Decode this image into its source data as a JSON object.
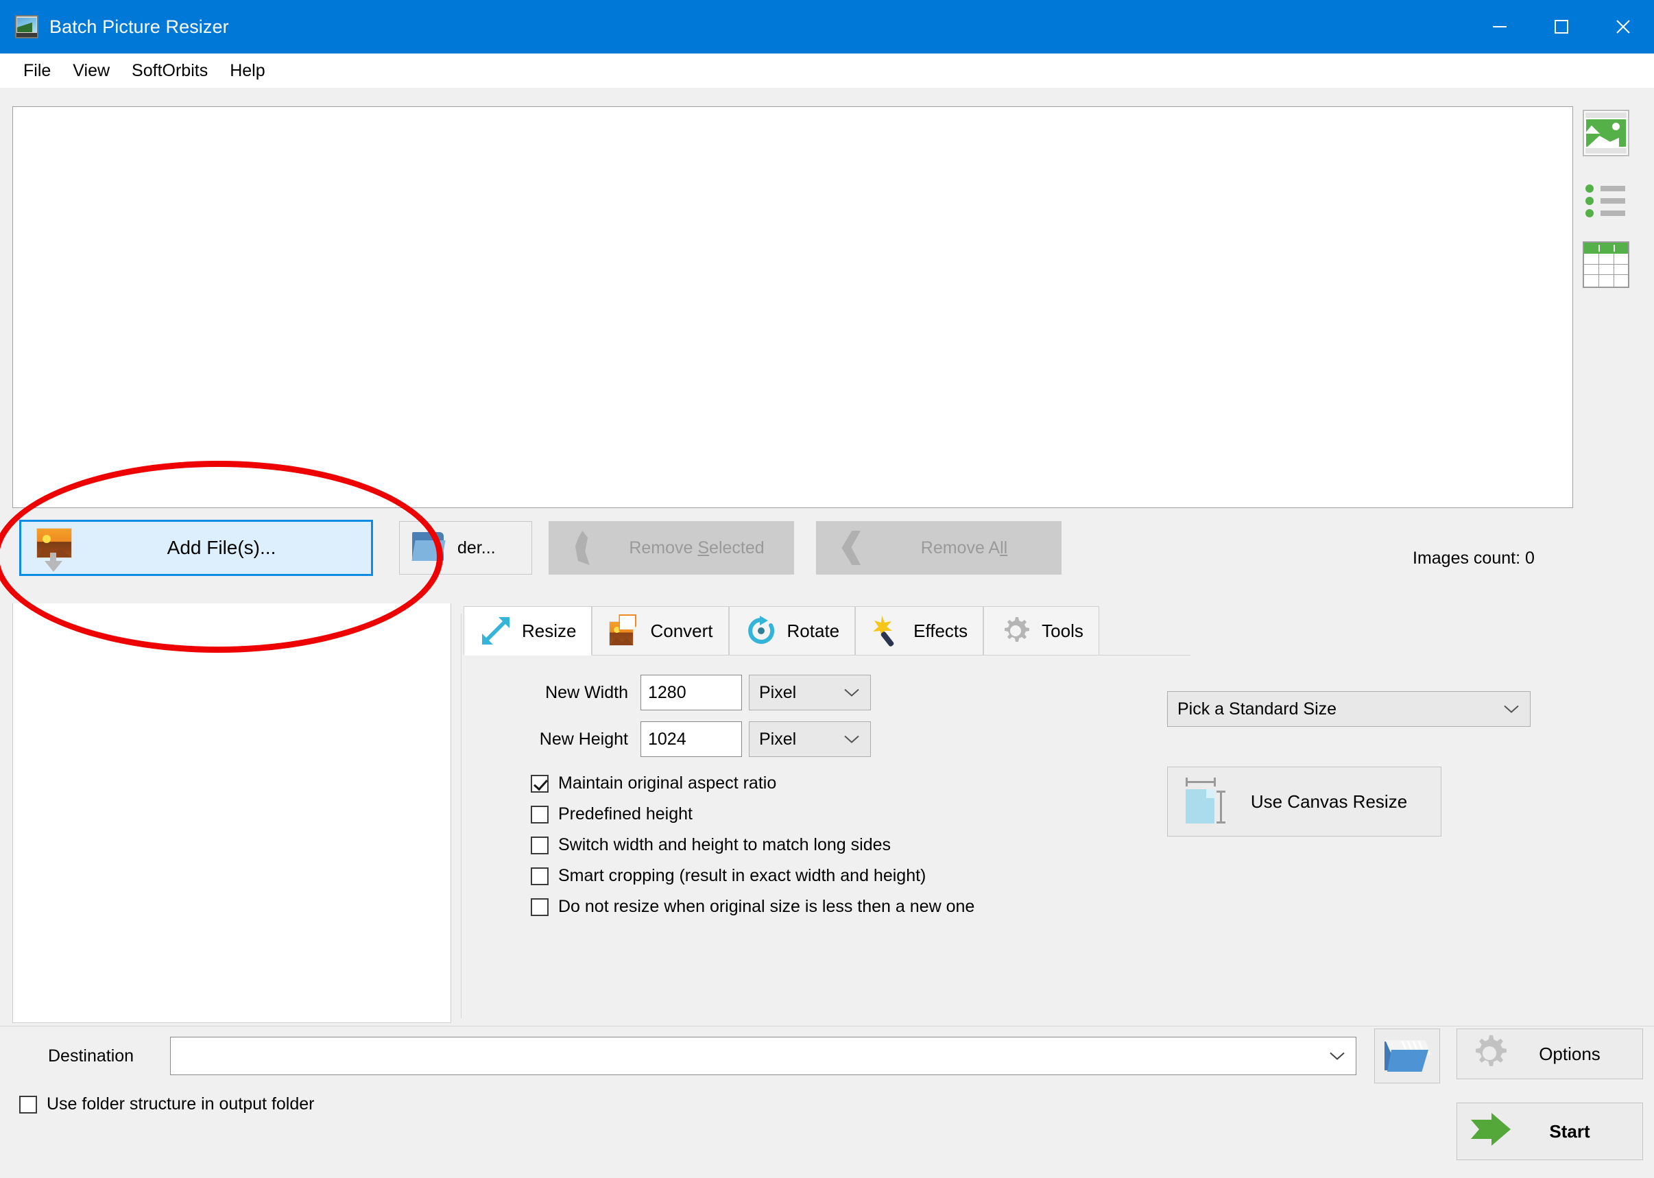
{
  "window": {
    "title": "Batch Picture Resizer",
    "app_icon": "picture-app-icon",
    "titlebar_color": "#0078d7",
    "controls": {
      "minimize": "minimize-icon",
      "maximize": "maximize-icon",
      "close": "close-icon"
    }
  },
  "menubar": {
    "items": [
      {
        "label": "File"
      },
      {
        "label": "View"
      },
      {
        "label": "SoftOrbits"
      },
      {
        "label": "Help"
      }
    ]
  },
  "view_modes": [
    {
      "name": "thumbnail-view",
      "icon": "thumbnail-view-icon"
    },
    {
      "name": "list-view",
      "icon": "list-view-icon"
    },
    {
      "name": "table-view",
      "icon": "table-view-icon"
    }
  ],
  "toolbar": {
    "add_files": {
      "label": "Add File(s)...",
      "icon": "add-picture-icon",
      "state": "focused",
      "accent": "#0c8ce4",
      "fill": "#ddeffc"
    },
    "add_folder": {
      "label": "der...",
      "full_label": "Add Folder...",
      "icon": "folder-icon"
    },
    "remove_selected": {
      "label_a": "Remove ",
      "label_accel": "S",
      "label_b": "elected",
      "icon": "remove-selected-icon",
      "state": "disabled"
    },
    "remove_all": {
      "label_a": "Remove A",
      "label_accel": "ll",
      "label_b": "",
      "icon": "remove-all-icon",
      "state": "disabled"
    },
    "images_count": "Images count: 0"
  },
  "tabs": [
    {
      "label": "Resize",
      "icon": "resize-arrows-icon",
      "active": true
    },
    {
      "label": "Convert",
      "icon": "convert-picture-icon",
      "active": false
    },
    {
      "label": "Rotate",
      "icon": "rotate-icon",
      "active": false
    },
    {
      "label": "Effects",
      "icon": "magic-wand-icon",
      "active": false
    },
    {
      "label": "Tools",
      "icon": "gear-icon",
      "active": false
    }
  ],
  "resize": {
    "new_width": {
      "label": "New Width",
      "value": "1280",
      "unit": "Pixel"
    },
    "new_height": {
      "label": "New Height",
      "value": "1024",
      "unit": "Pixel"
    },
    "standard_size": {
      "value": "Pick a Standard Size"
    },
    "canvas_resize": {
      "label": "Use Canvas Resize",
      "icon": "canvas-resize-icon"
    },
    "checkboxes": [
      {
        "label": "Maintain original aspect ratio",
        "checked": true
      },
      {
        "label": "Predefined height",
        "checked": false
      },
      {
        "label": "Switch width and height to match long sides",
        "checked": false
      },
      {
        "label": "Smart cropping (result in exact width and height)",
        "checked": false
      },
      {
        "label": "Do not resize when original size is less then a new one",
        "checked": false
      }
    ]
  },
  "bottom": {
    "destination_label": "Destination",
    "destination_value": "",
    "destination_placeholder": "",
    "browse": {
      "icon": "open-folder-icon"
    },
    "options": {
      "label": "Options",
      "icon": "gear-icon"
    },
    "start": {
      "label": "Start",
      "icon": "green-arrow-icon",
      "accent": "#54a83a"
    },
    "use_folder_structure": {
      "label": "Use folder structure in output folder",
      "checked": false
    }
  },
  "annotation": {
    "type": "ellipse-highlight",
    "color": "#ee0000",
    "targets": "add-files-button"
  }
}
